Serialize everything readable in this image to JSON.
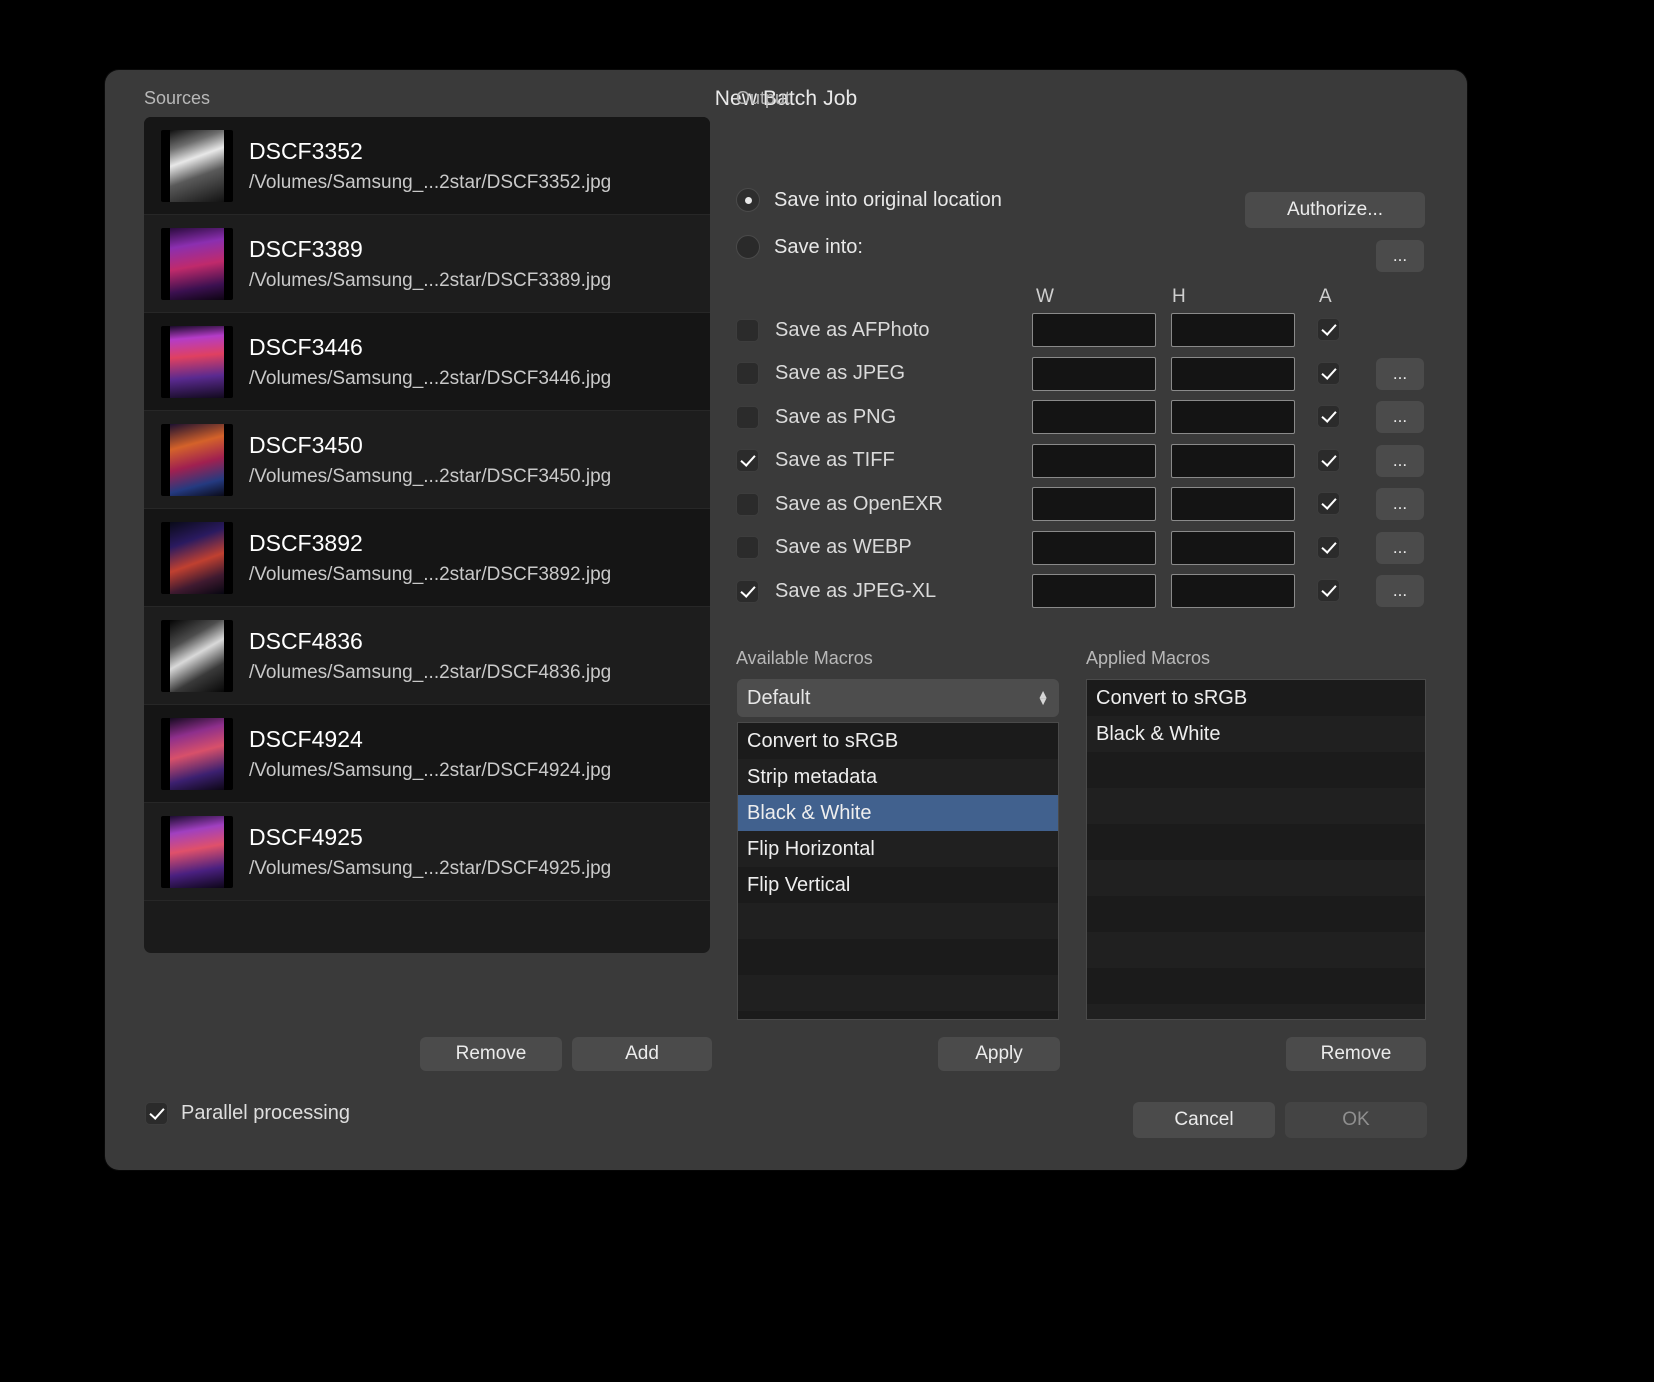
{
  "window": {
    "title": "New Batch Job"
  },
  "sources": {
    "label": "Sources",
    "items": [
      {
        "name": "DSCF3352",
        "path": "/Volumes/Samsung_...2star/DSCF3352.jpg",
        "thumb": "bw-portrait"
      },
      {
        "name": "DSCF3389",
        "path": "/Volumes/Samsung_...2star/DSCF3389.jpg",
        "thumb": "purple-crowd"
      },
      {
        "name": "DSCF3446",
        "path": "/Volumes/Samsung_...2star/DSCF3446.jpg",
        "thumb": "magenta-stage"
      },
      {
        "name": "DSCF3450",
        "path": "/Volumes/Samsung_...2star/DSCF3450.jpg",
        "thumb": "orange-blue"
      },
      {
        "name": "DSCF3892",
        "path": "/Volumes/Samsung_...2star/DSCF3892.jpg",
        "thumb": "dark-blue-fire"
      },
      {
        "name": "DSCF4836",
        "path": "/Volumes/Samsung_...2star/DSCF4836.jpg",
        "thumb": "bw-band"
      },
      {
        "name": "DSCF4924",
        "path": "/Volumes/Samsung_...2star/DSCF4924.jpg",
        "thumb": "pink-singer"
      },
      {
        "name": "DSCF4925",
        "path": "/Volumes/Samsung_...2star/DSCF4925.jpg",
        "thumb": "violet-crowd"
      }
    ],
    "remove_label": "Remove",
    "add_label": "Add"
  },
  "output": {
    "label": "Output",
    "radio_original": {
      "label": "Save into original location",
      "selected": true
    },
    "radio_into": {
      "label": "Save into:",
      "selected": false
    },
    "authorize_label": "Authorize...",
    "browse_label": "...",
    "columns": {
      "w": "W",
      "h": "H",
      "a": "A"
    },
    "formats": [
      {
        "label": "Save as AFPhoto",
        "checked": false,
        "w": "",
        "h": "",
        "a": true,
        "has_options": false
      },
      {
        "label": "Save as JPEG",
        "checked": false,
        "w": "",
        "h": "",
        "a": true,
        "has_options": true
      },
      {
        "label": "Save as PNG",
        "checked": false,
        "w": "",
        "h": "",
        "a": true,
        "has_options": true
      },
      {
        "label": "Save as TIFF",
        "checked": true,
        "w": "",
        "h": "",
        "a": true,
        "has_options": true
      },
      {
        "label": "Save as OpenEXR",
        "checked": false,
        "w": "",
        "h": "",
        "a": true,
        "has_options": true
      },
      {
        "label": "Save as WEBP",
        "checked": false,
        "w": "",
        "h": "",
        "a": true,
        "has_options": true
      },
      {
        "label": "Save as JPEG-XL",
        "checked": true,
        "w": "",
        "h": "",
        "a": true,
        "has_options": true
      }
    ]
  },
  "macros": {
    "available_label": "Available Macros",
    "applied_label": "Applied Macros",
    "selected_set": "Default",
    "set_options": [
      "Default"
    ],
    "available": [
      {
        "label": "Convert to sRGB",
        "selected": false
      },
      {
        "label": "Strip metadata",
        "selected": false
      },
      {
        "label": "Black & White",
        "selected": true
      },
      {
        "label": "Flip Horizontal",
        "selected": false
      },
      {
        "label": "Flip Vertical",
        "selected": false
      }
    ],
    "applied": [
      "Convert to sRGB",
      "Black & White"
    ],
    "apply_label": "Apply",
    "remove_label": "Remove"
  },
  "footer": {
    "parallel_label": "Parallel processing",
    "parallel_checked": true,
    "cancel_label": "Cancel",
    "ok_label": "OK"
  },
  "colors": {
    "dialog_bg": "#3a3a3a",
    "list_bg": "#1b1b1b",
    "selection_blue": "#41618e",
    "button_bg": "#4b4b4b"
  }
}
